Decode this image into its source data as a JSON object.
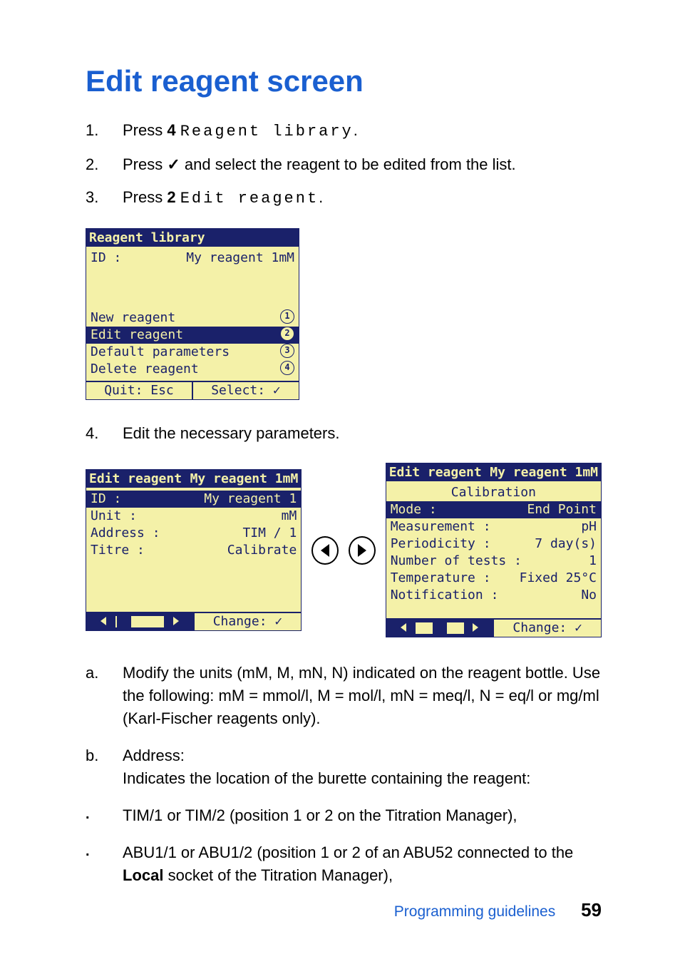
{
  "title": "Edit reagent screen",
  "steps": {
    "s1": {
      "num": "1.",
      "pre": "Press ",
      "bold": "4 ",
      "mono": "Reagent library",
      "post": "."
    },
    "s2": {
      "num": "2.",
      "pre": "Press ",
      "check": "✓",
      "post": " and select the reagent to be edited from the list."
    },
    "s3": {
      "num": "3.",
      "pre": "Press ",
      "bold": "2 ",
      "mono": "Edit reagent",
      "post": "."
    },
    "s4": {
      "num": "4.",
      "text": "Edit the necessary parameters."
    }
  },
  "lcd1": {
    "title": "Reagent library",
    "id_label": "ID :",
    "id_value": "My reagent 1mM",
    "menu": {
      "m1": {
        "label": "New reagent",
        "badge": "1"
      },
      "m2": {
        "label": "Edit reagent",
        "badge": "2"
      },
      "m3": {
        "label": "Default parameters",
        "badge": "3"
      },
      "m4": {
        "label": "Delete reagent",
        "badge": "4"
      }
    },
    "footer_left": "Quit: Esc",
    "footer_right": "Select: ✓"
  },
  "lcd2": {
    "bar_left": "Edit reagent",
    "bar_right": "My reagent 1mM",
    "rows": {
      "r1": {
        "label": "ID :",
        "value": "My reagent 1"
      },
      "r2": {
        "label": "Unit :",
        "value": "mM"
      },
      "r3": {
        "label": "Address :",
        "value": "TIM / 1"
      },
      "r4": {
        "label": "Titre :",
        "value": "Calibrate"
      }
    },
    "footer_right": "Change: ✓"
  },
  "lcd3": {
    "bar_left": "Edit reagent",
    "bar_right": "My reagent 1mM",
    "subtitle": "Calibration",
    "rows": {
      "r1": {
        "label": "Mode :",
        "value": "End Point"
      },
      "r2": {
        "label": "Measurement :",
        "value": "pH"
      },
      "r3": {
        "label": "Periodicity :",
        "value": "7 day(s)"
      },
      "r4": {
        "label": "Number of tests :",
        "value": "1"
      },
      "r5": {
        "label": "Temperature :",
        "value": "Fixed 25°C"
      },
      "r6": {
        "label": "Notification :",
        "value": "No"
      }
    },
    "footer_right": "Change: ✓"
  },
  "sub": {
    "a": {
      "mk": "a.",
      "text": "Modify the units (mM, M, mN, N) indicated on the reagent bottle. Use the following: mM = mmol/l, M = mol/l, mN = meq/l, N = eq/l or mg/ml (Karl-Fischer reagents only)."
    },
    "b": {
      "mk": "b.",
      "line1": "Address:",
      "line2": "Indicates the location of the burette containing the reagent:"
    },
    "bullet1": {
      "text": "TIM/1 or TIM/2 (position 1 or 2 on the Titration Manager),"
    },
    "bullet2": {
      "pre": "ABU1/1 or ABU1/2 (position 1 or 2 of an ABU52 connected to the ",
      "bold": "Local",
      "post": " socket of the Titration Manager),"
    }
  },
  "footer": {
    "guide": "Programming guidelines",
    "page": "59"
  },
  "icons": {
    "left_arrow": "left-arrow-icon",
    "right_arrow": "right-arrow-icon"
  }
}
